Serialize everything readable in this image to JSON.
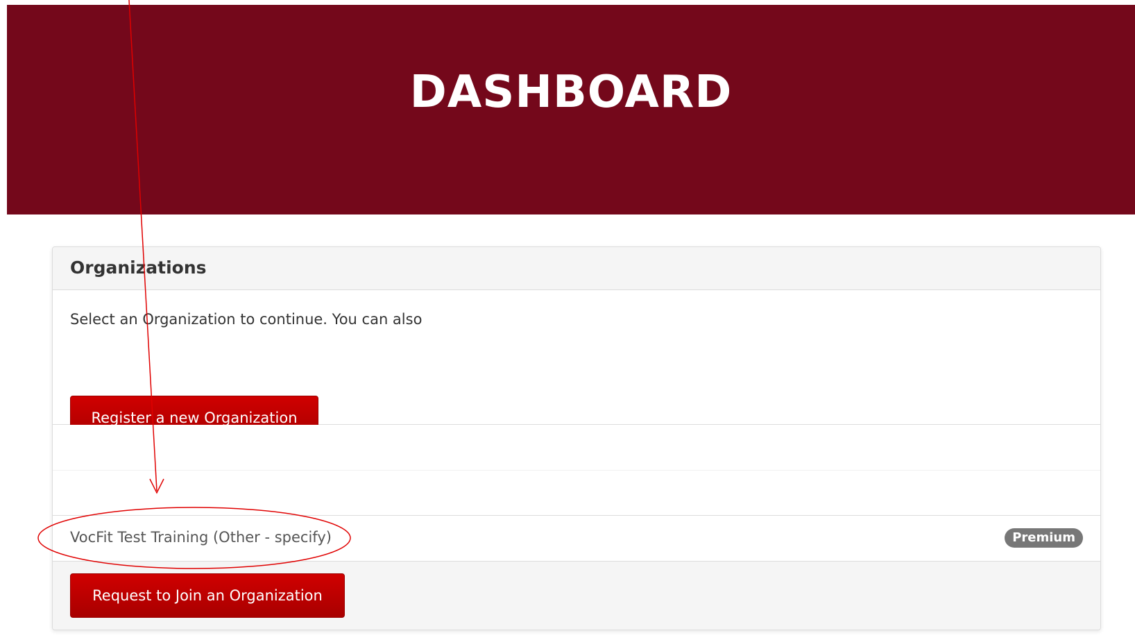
{
  "hero": {
    "title": "DASHBOARD"
  },
  "organizations": {
    "title": "Organizations",
    "intro_text": "Select an Organization to continue. You can also",
    "register_button_label": "Register a new Organization",
    "items": [
      {
        "name": "VocFit Test Training (Other - specify)",
        "badge": "Premium"
      }
    ],
    "join_button_label": "Request to Join an Organization"
  },
  "colors": {
    "hero_background": "#74081b",
    "button_red": "#c00000",
    "annotation_red": "#e00000",
    "badge_gray": "#777777"
  }
}
